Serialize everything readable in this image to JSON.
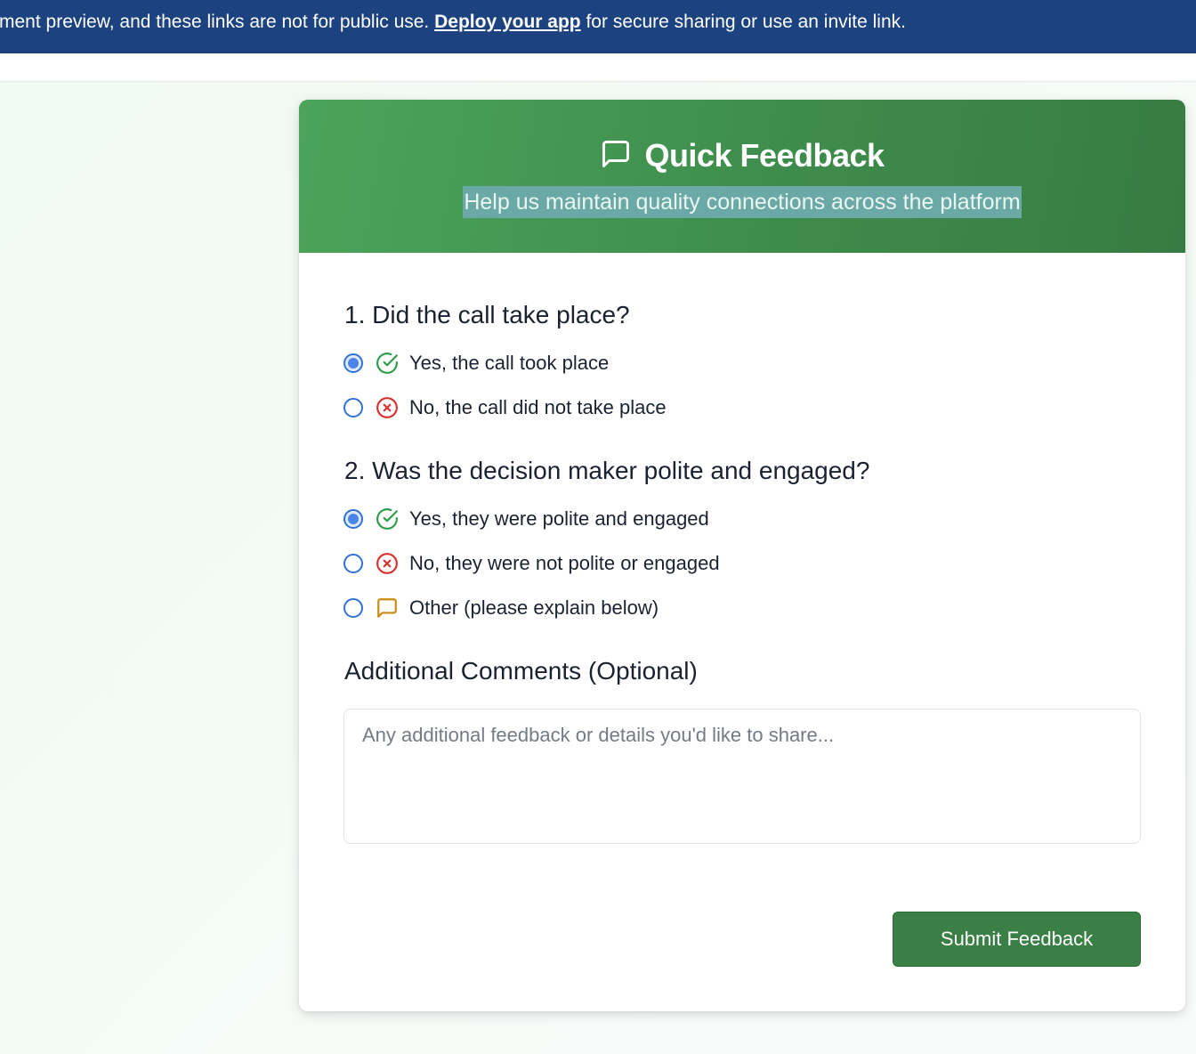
{
  "banner": {
    "text_before": "ment preview, and these links are not for public use. ",
    "link": "Deploy your app",
    "text_after": " for secure sharing or use an invite link."
  },
  "header": {
    "title": "Quick Feedback",
    "subtitle": "Help us maintain quality connections across the platform",
    "icon": "message-square-icon"
  },
  "questions": [
    {
      "title": "1. Did the call take place?",
      "options": [
        {
          "label": "Yes, the call took place",
          "icon": "check-circle-icon",
          "selected": true
        },
        {
          "label": "No, the call did not take place",
          "icon": "x-circle-icon",
          "selected": false
        }
      ]
    },
    {
      "title": "2. Was the decision maker polite and engaged?",
      "options": [
        {
          "label": "Yes, they were polite and engaged",
          "icon": "check-circle-icon",
          "selected": true
        },
        {
          "label": "No, they were not polite or engaged",
          "icon": "x-circle-icon",
          "selected": false
        },
        {
          "label": "Other (please explain below)",
          "icon": "message-square-icon",
          "selected": false
        }
      ]
    }
  ],
  "comments": {
    "title": "Additional Comments (Optional)",
    "placeholder": "Any additional feedback or details you'd like to share...",
    "value": ""
  },
  "submit_label": "Submit Feedback",
  "colors": {
    "banner": "#1c4280",
    "header_green": "#4ba45a",
    "button_green": "#3a7f45",
    "check_green": "#2e9e4a",
    "x_red": "#d9302c",
    "other_amber": "#c98a12",
    "radio_blue": "#2f73d9"
  }
}
